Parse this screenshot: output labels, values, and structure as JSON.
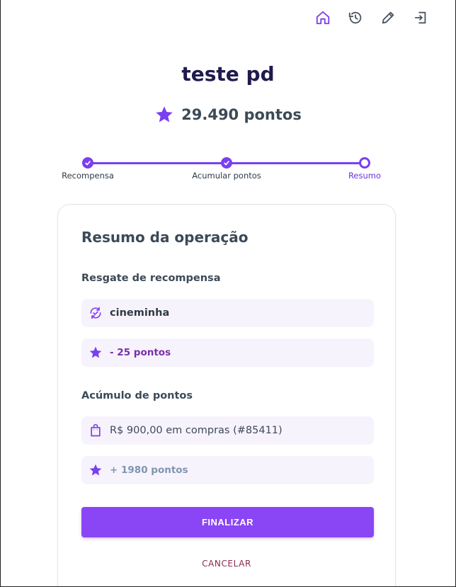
{
  "toolbar": {
    "icons": [
      "home-icon",
      "history-icon",
      "edit-icon",
      "logout-icon"
    ]
  },
  "header": {
    "title": "teste pd",
    "points": "29.490 pontos"
  },
  "stepper": {
    "steps": [
      {
        "label": "Recompensa",
        "state": "done"
      },
      {
        "label": "Acumular pontos",
        "state": "done"
      },
      {
        "label": "Resumo",
        "state": "current"
      }
    ]
  },
  "card": {
    "title": "Resumo da operação",
    "redeem": {
      "section_title": "Resgate de recompensa",
      "reward_name": "cineminha",
      "reward_points": "- 25 pontos"
    },
    "accrual": {
      "section_title": "Acúmulo de pontos",
      "purchase": "R$ 900,00 em compras (#85411)",
      "earned_points": "+ 1980 pontos"
    },
    "finalize_label": "FINALIZAR",
    "cancel_label": "CANCELAR"
  },
  "colors": {
    "accent": "#8a45f5",
    "title": "#1f1b4d",
    "pill_bg": "#f7f3fd",
    "cancel": "#8a2a52"
  }
}
